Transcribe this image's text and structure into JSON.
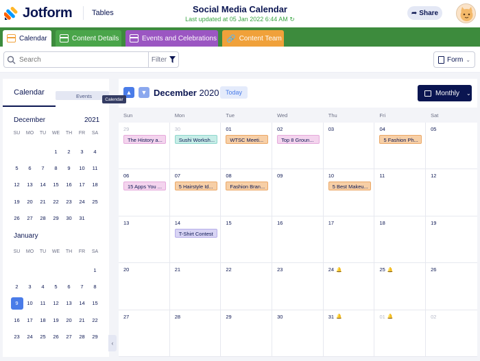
{
  "header": {
    "brand": "Jotform",
    "section": "Tables",
    "title": "Social Media Calendar",
    "updated": "Last updated at 05 Jan 2022 6:44 AM",
    "share": "Share"
  },
  "tabs": [
    {
      "label": "Calendar"
    },
    {
      "label": "Content Details"
    },
    {
      "label": "Events and Celebrations"
    },
    {
      "label": "Content Team"
    }
  ],
  "toolbar": {
    "search_placeholder": "Search",
    "filter": "Filter",
    "form": "Form"
  },
  "sidebar": {
    "tab_calendar": "Calendar",
    "tab_events": "Events",
    "tooltip": "Calendar",
    "dows": [
      "SU",
      "MO",
      "TU",
      "WE",
      "TH",
      "FR",
      "SA"
    ],
    "dec": {
      "month": "December",
      "year": "2021",
      "days": [
        "",
        "",
        "",
        "1",
        "2",
        "3",
        "4",
        "5",
        "6",
        "7",
        "8",
        "9",
        "10",
        "11",
        "12",
        "13",
        "14",
        "15",
        "16",
        "17",
        "18",
        "19",
        "20",
        "21",
        "22",
        "23",
        "24",
        "25",
        "26",
        "27",
        "28",
        "29",
        "30",
        "31",
        ""
      ]
    },
    "jan": {
      "month": "January",
      "days": [
        "",
        "",
        "",
        "",
        "",
        "",
        "1",
        "2",
        "3",
        "4",
        "5",
        "6",
        "7",
        "8",
        "9",
        "10",
        "11",
        "12",
        "13",
        "14",
        "15",
        "16",
        "17",
        "18",
        "19",
        "20",
        "21",
        "22",
        "23",
        "24",
        "25",
        "26",
        "27",
        "28",
        "29"
      ],
      "selected": "9"
    }
  },
  "calendar": {
    "month": "December",
    "year": "2020",
    "today": "Today",
    "view": "Monthly",
    "dows": [
      "Sun",
      "Mon",
      "Tue",
      "Wed",
      "Thu",
      "Fri",
      "Sat"
    ],
    "cells": [
      {
        "day": "29",
        "muted": true,
        "event": "The History a...",
        "color": "pink"
      },
      {
        "day": "30",
        "muted": true,
        "event": "Sushi Worksh...",
        "color": "teal"
      },
      {
        "day": "01",
        "event": "WTSC Meeti...",
        "color": "orange"
      },
      {
        "day": "02",
        "event": "Top 8 Groun...",
        "color": "pink"
      },
      {
        "day": "03"
      },
      {
        "day": "04",
        "event": "5 Fashion Ph...",
        "color": "orange"
      },
      {
        "day": "05"
      },
      {
        "day": "06",
        "event": "15 Apps You ...",
        "color": "pink"
      },
      {
        "day": "07",
        "event": "5 Hairstyle Id...",
        "color": "orange"
      },
      {
        "day": "08",
        "event": "Fashion Bran...",
        "color": "orange"
      },
      {
        "day": "09"
      },
      {
        "day": "10",
        "event": "5 Best Makeu...",
        "color": "orange"
      },
      {
        "day": "11"
      },
      {
        "day": "12"
      },
      {
        "day": "13"
      },
      {
        "day": "14",
        "event": "T-Shirt Contest",
        "color": "purple"
      },
      {
        "day": "15"
      },
      {
        "day": "16"
      },
      {
        "day": "17"
      },
      {
        "day": "18"
      },
      {
        "day": "19"
      },
      {
        "day": "20"
      },
      {
        "day": "21"
      },
      {
        "day": "22"
      },
      {
        "day": "23"
      },
      {
        "day": "24",
        "bell": true
      },
      {
        "day": "25",
        "bell": true
      },
      {
        "day": "26"
      },
      {
        "day": "27"
      },
      {
        "day": "28"
      },
      {
        "day": "29"
      },
      {
        "day": "30"
      },
      {
        "day": "31",
        "bell": true
      },
      {
        "day": "01",
        "muted": true,
        "bell": true
      },
      {
        "day": "02",
        "muted": true
      }
    ]
  }
}
